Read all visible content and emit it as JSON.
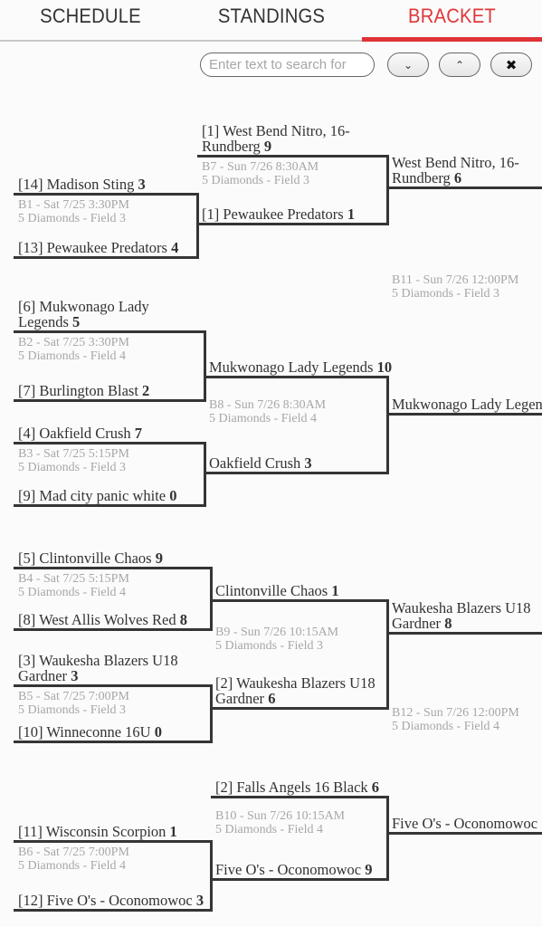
{
  "tabs": [
    {
      "label": "SCHEDULE",
      "active": false
    },
    {
      "label": "STANDINGS",
      "active": false
    },
    {
      "label": "BRACKET",
      "active": true
    }
  ],
  "accent_color": "#df3337",
  "search": {
    "placeholder": "Enter text to search for",
    "value": "",
    "next_icon": "chevron-down-icon",
    "prev_icon": "chevron-up-icon",
    "close_icon": "close-icon"
  },
  "icons": {
    "down": "⌄",
    "up": "⌃",
    "close": "✖"
  },
  "bracket": {
    "round1": [
      {
        "game": "B1",
        "meta_line1": "B1 - Sat 7/25 3:30PM",
        "meta_line2": "5 Diamonds - Field 3",
        "top": {
          "name_line1": "[14] Madison Sting",
          "name_line2": "",
          "score": "3"
        },
        "bottom": {
          "name_line1": "[13] Pewaukee Predators",
          "name_line2": "",
          "score": "4"
        }
      },
      {
        "game": "B2",
        "meta_line1": "B2 - Sat 7/25 3:30PM",
        "meta_line2": "5 Diamonds - Field 4",
        "top": {
          "name_line1": "[6] Mukwonago Lady",
          "name_line2": "Legends",
          "score": "5"
        },
        "bottom": {
          "name_line1": "[7] Burlington Blast",
          "name_line2": "",
          "score": "2"
        }
      },
      {
        "game": "B3",
        "meta_line1": "B3 - Sat 7/25 5:15PM",
        "meta_line2": "5 Diamonds - Field 3",
        "top": {
          "name_line1": "[4] Oakfield Crush",
          "name_line2": "",
          "score": "7"
        },
        "bottom": {
          "name_line1": "[9] Mad city panic white",
          "name_line2": "",
          "score": "0"
        }
      },
      {
        "game": "B4",
        "meta_line1": "B4 - Sat 7/25 5:15PM",
        "meta_line2": "5 Diamonds - Field 4",
        "top": {
          "name_line1": "[5] Clintonville Chaos",
          "name_line2": "",
          "score": "9"
        },
        "bottom": {
          "name_line1": "[8] West Allis Wolves Red",
          "name_line2": "",
          "score": "8"
        }
      },
      {
        "game": "B5",
        "meta_line1": "B5 - Sat 7/25 7:00PM",
        "meta_line2": "5 Diamonds - Field 3",
        "top": {
          "name_line1": "[3] Waukesha Blazers U18",
          "name_line2": "Gardner",
          "score": "3"
        },
        "bottom": {
          "name_line1": "[10] Winneconne 16U",
          "name_line2": "",
          "score": "0"
        }
      },
      {
        "game": "B6",
        "meta_line1": "B6 - Sat 7/25 7:00PM",
        "meta_line2": "5 Diamonds - Field 4",
        "top": {
          "name_line1": "[11] Wisconsin Scorpion",
          "name_line2": "",
          "score": "1"
        },
        "bottom": {
          "name_line1": "[12] Five O's - Oconomowoc",
          "name_line2": "",
          "score": "3"
        }
      }
    ],
    "round2": [
      {
        "game": "B7",
        "meta_line1": "B7 - Sun 7/26 8:30AM",
        "meta_line2": "5 Diamonds - Field 3",
        "top": {
          "name_line1": "[1] West Bend Nitro, 16-",
          "name_line2": "Rundberg",
          "score": "9"
        },
        "bottom": {
          "name_line1": "[1] Pewaukee Predators",
          "name_line2": "",
          "score": "1"
        }
      },
      {
        "game": "B8",
        "meta_line1": "B8 - Sun 7/26 8:30AM",
        "meta_line2": "5 Diamonds - Field 4",
        "top": {
          "name_line1": "Mukwonago Lady Legends",
          "name_line2": "",
          "score": "10"
        },
        "bottom": {
          "name_line1": "Oakfield Crush",
          "name_line2": "",
          "score": "3"
        }
      },
      {
        "game": "B9",
        "meta_line1": "B9 - Sun 7/26 10:15AM",
        "meta_line2": "5 Diamonds - Field 3",
        "top": {
          "name_line1": "Clintonville Chaos",
          "name_line2": "",
          "score": "1"
        },
        "bottom": {
          "name_line1": "[2] Waukesha Blazers U18",
          "name_line2": "Gardner",
          "score": "6"
        }
      },
      {
        "game": "B10",
        "meta_line1": "B10 - Sun 7/26 10:15AM",
        "meta_line2": "5 Diamonds - Field 4",
        "top": {
          "name_line1": "[2] Falls Angels 16 Black",
          "name_line2": "",
          "score": "6"
        },
        "bottom": {
          "name_line1": "Five O's - Oconomowoc",
          "name_line2": "",
          "score": "9"
        }
      }
    ],
    "round3": [
      {
        "game": "B11",
        "meta_line1": "B11 - Sun 7/26 12:00PM",
        "meta_line2": "5 Diamonds - Field 3",
        "top": {
          "name_line1": "West Bend Nitro, 16-",
          "name_line2": "Rundberg",
          "score": "6"
        },
        "bottom": {
          "name_line1": "Mukwonago Lady Legends",
          "name_line2": "",
          "score": ""
        }
      },
      {
        "game": "B12",
        "meta_line1": "B12 - Sun 7/26 12:00PM",
        "meta_line2": "5 Diamonds - Field 4",
        "top": {
          "name_line1": "Waukesha Blazers U18",
          "name_line2": "Gardner",
          "score": "8"
        },
        "bottom": {
          "name_line1": "Five O's - Oconomowoc",
          "name_line2": "",
          "score": ""
        }
      }
    ]
  }
}
